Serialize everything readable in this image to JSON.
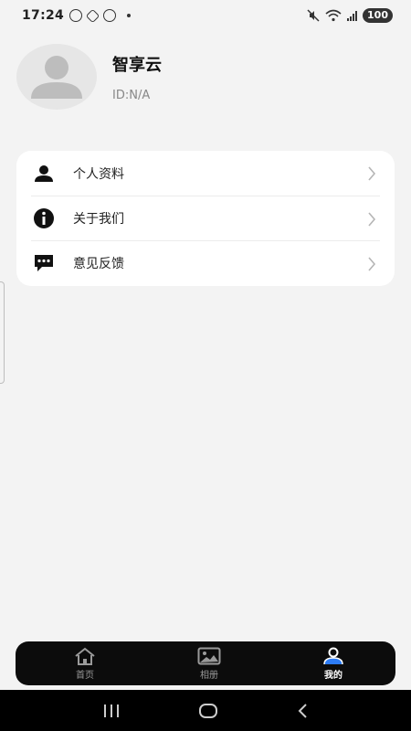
{
  "status_bar": {
    "time": "17:24",
    "battery": "100"
  },
  "profile": {
    "name": "智享云",
    "id_text": "ID:N/A"
  },
  "menu": {
    "items": [
      {
        "label": "个人资料",
        "icon": "person-icon"
      },
      {
        "label": "关于我们",
        "icon": "info-icon"
      },
      {
        "label": "意见反馈",
        "icon": "feedback-icon"
      }
    ]
  },
  "tab_bar": {
    "tabs": [
      {
        "label": "首页",
        "icon": "home-icon",
        "active": false
      },
      {
        "label": "相册",
        "icon": "album-icon",
        "active": false
      },
      {
        "label": "我的",
        "icon": "profile-icon",
        "active": true
      }
    ]
  },
  "colors": {
    "background": "#f3f3f3",
    "card": "#ffffff",
    "tab_bar": "#0c0c0c",
    "accent": "#2d7cf6"
  }
}
